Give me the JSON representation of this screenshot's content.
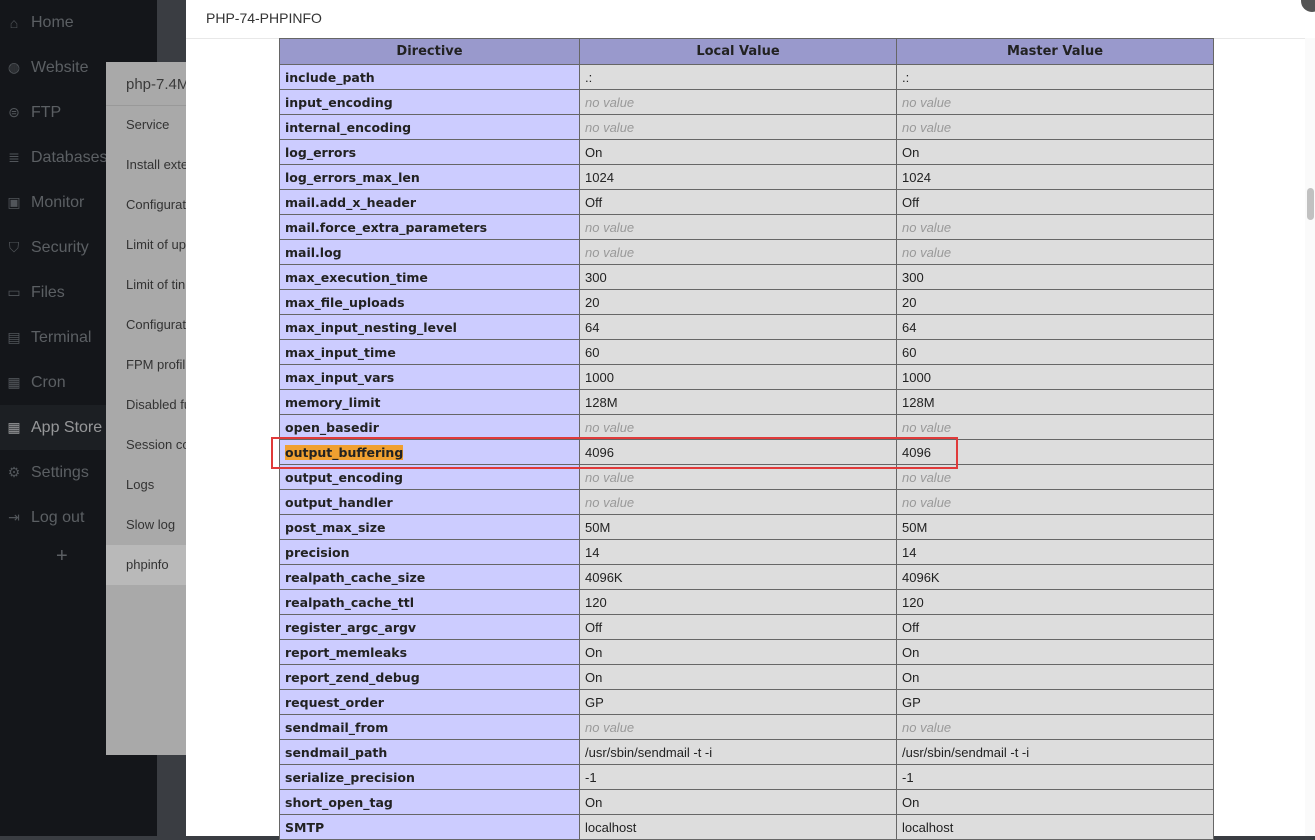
{
  "sidebar": {
    "items": [
      {
        "label": "Home",
        "icon": "home-icon"
      },
      {
        "label": "Website",
        "icon": "globe-icon"
      },
      {
        "label": "FTP",
        "icon": "ftp-icon"
      },
      {
        "label": "Databases",
        "icon": "database-icon"
      },
      {
        "label": "Monitor",
        "icon": "monitor-icon"
      },
      {
        "label": "Security",
        "icon": "shield-icon"
      },
      {
        "label": "Files",
        "icon": "folder-icon"
      },
      {
        "label": "Terminal",
        "icon": "terminal-icon"
      },
      {
        "label": "Cron",
        "icon": "calendar-icon"
      },
      {
        "label": "App Store",
        "icon": "grid-icon"
      },
      {
        "label": "Settings",
        "icon": "gear-icon"
      },
      {
        "label": "Log out",
        "icon": "logout-icon"
      }
    ],
    "active_index": 9,
    "add_label": "+"
  },
  "panel": {
    "title": "php-7.4M",
    "items": [
      "Service",
      "Install exte",
      "Configurat",
      "Limit of up",
      "Limit of tin",
      "Configurat",
      "FPM profil",
      "Disabled fu",
      "Session co",
      "Logs",
      "Slow log",
      "phpinfo"
    ],
    "active_index": 11
  },
  "dialog": {
    "title": "PHP-74-PHPINFO"
  },
  "table": {
    "headers": [
      "Directive",
      "Local Value",
      "Master Value"
    ],
    "no_value_text": "no value",
    "highlight_row": "output_buffering",
    "rows": [
      [
        "include_path",
        ".:",
        ".:"
      ],
      [
        "input_encoding",
        "no value",
        "no value"
      ],
      [
        "internal_encoding",
        "no value",
        "no value"
      ],
      [
        "log_errors",
        "On",
        "On"
      ],
      [
        "log_errors_max_len",
        "1024",
        "1024"
      ],
      [
        "mail.add_x_header",
        "Off",
        "Off"
      ],
      [
        "mail.force_extra_parameters",
        "no value",
        "no value"
      ],
      [
        "mail.log",
        "no value",
        "no value"
      ],
      [
        "max_execution_time",
        "300",
        "300"
      ],
      [
        "max_file_uploads",
        "20",
        "20"
      ],
      [
        "max_input_nesting_level",
        "64",
        "64"
      ],
      [
        "max_input_time",
        "60",
        "60"
      ],
      [
        "max_input_vars",
        "1000",
        "1000"
      ],
      [
        "memory_limit",
        "128M",
        "128M"
      ],
      [
        "open_basedir",
        "no value",
        "no value"
      ],
      [
        "output_buffering",
        "4096",
        "4096"
      ],
      [
        "output_encoding",
        "no value",
        "no value"
      ],
      [
        "output_handler",
        "no value",
        "no value"
      ],
      [
        "post_max_size",
        "50M",
        "50M"
      ],
      [
        "precision",
        "14",
        "14"
      ],
      [
        "realpath_cache_size",
        "4096K",
        "4096K"
      ],
      [
        "realpath_cache_ttl",
        "120",
        "120"
      ],
      [
        "register_argc_argv",
        "Off",
        "Off"
      ],
      [
        "report_memleaks",
        "On",
        "On"
      ],
      [
        "report_zend_debug",
        "On",
        "On"
      ],
      [
        "request_order",
        "GP",
        "GP"
      ],
      [
        "sendmail_from",
        "no value",
        "no value"
      ],
      [
        "sendmail_path",
        "/usr/sbin/sendmail -t -i",
        "/usr/sbin/sendmail -t -i"
      ],
      [
        "serialize_precision",
        "-1",
        "-1"
      ],
      [
        "short_open_tag",
        "On",
        "On"
      ],
      [
        "SMTP",
        "localhost",
        "localhost"
      ]
    ]
  },
  "colors": {
    "header_bg": "#9999cc",
    "directive_bg": "#ccccff",
    "value_bg": "#dddddd",
    "highlight": "#f0a030",
    "annotation_border": "#e03a3a"
  }
}
